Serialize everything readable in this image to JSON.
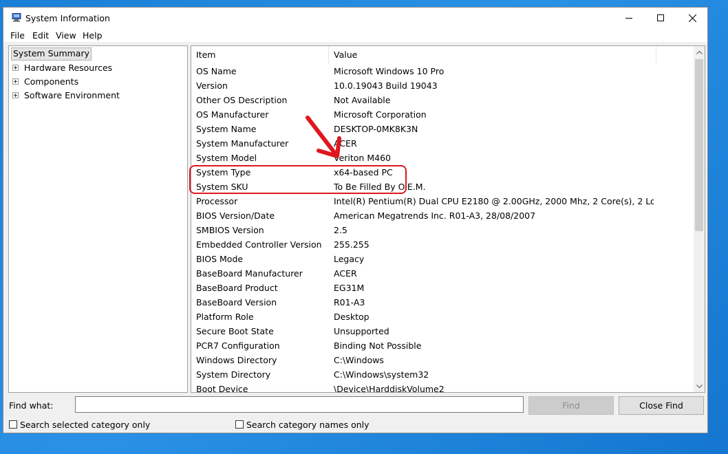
{
  "window": {
    "title": "System Information"
  },
  "menu": [
    "File",
    "Edit",
    "View",
    "Help"
  ],
  "tree": {
    "root": "System Summary",
    "children": [
      "Hardware Resources",
      "Components",
      "Software Environment"
    ]
  },
  "list": {
    "columns": [
      "Item",
      "Value"
    ],
    "rows": [
      {
        "item": "OS Name",
        "value": "Microsoft Windows 10 Pro"
      },
      {
        "item": "Version",
        "value": "10.0.19043 Build 19043"
      },
      {
        "item": "Other OS Description",
        "value": "Not Available"
      },
      {
        "item": "OS Manufacturer",
        "value": "Microsoft Corporation"
      },
      {
        "item": "System Name",
        "value": "DESKTOP-0MK8K3N"
      },
      {
        "item": "System Manufacturer",
        "value": "ACER"
      },
      {
        "item": "System Model",
        "value": "Veriton M460"
      },
      {
        "item": "System Type",
        "value": "x64-based PC"
      },
      {
        "item": "System SKU",
        "value": "To Be Filled By O.E.M."
      },
      {
        "item": "Processor",
        "value": "Intel(R) Pentium(R) Dual  CPU  E2180  @ 2.00GHz, 2000 Mhz, 2 Core(s), 2 Logi..."
      },
      {
        "item": "BIOS Version/Date",
        "value": "American Megatrends Inc. R01-A3, 28/08/2007"
      },
      {
        "item": "SMBIOS Version",
        "value": "2.5"
      },
      {
        "item": "Embedded Controller Version",
        "value": "255.255"
      },
      {
        "item": "BIOS Mode",
        "value": "Legacy"
      },
      {
        "item": "BaseBoard Manufacturer",
        "value": "ACER"
      },
      {
        "item": "BaseBoard Product",
        "value": "EG31M"
      },
      {
        "item": "BaseBoard Version",
        "value": "R01-A3"
      },
      {
        "item": "Platform Role",
        "value": "Desktop"
      },
      {
        "item": "Secure Boot State",
        "value": "Unsupported"
      },
      {
        "item": "PCR7 Configuration",
        "value": "Binding Not Possible"
      },
      {
        "item": "Windows Directory",
        "value": "C:\\Windows"
      },
      {
        "item": "System Directory",
        "value": "C:\\Windows\\system32"
      },
      {
        "item": "Boot Device",
        "value": "\\Device\\HarddiskVolume2"
      }
    ]
  },
  "find": {
    "label": "Find what:",
    "input_value": "",
    "find_button": "Find",
    "close_button": "Close Find",
    "option_selected_category": "Search selected category only",
    "option_category_names": "Search category names only"
  },
  "annotation": {
    "color": "#e0161e"
  }
}
